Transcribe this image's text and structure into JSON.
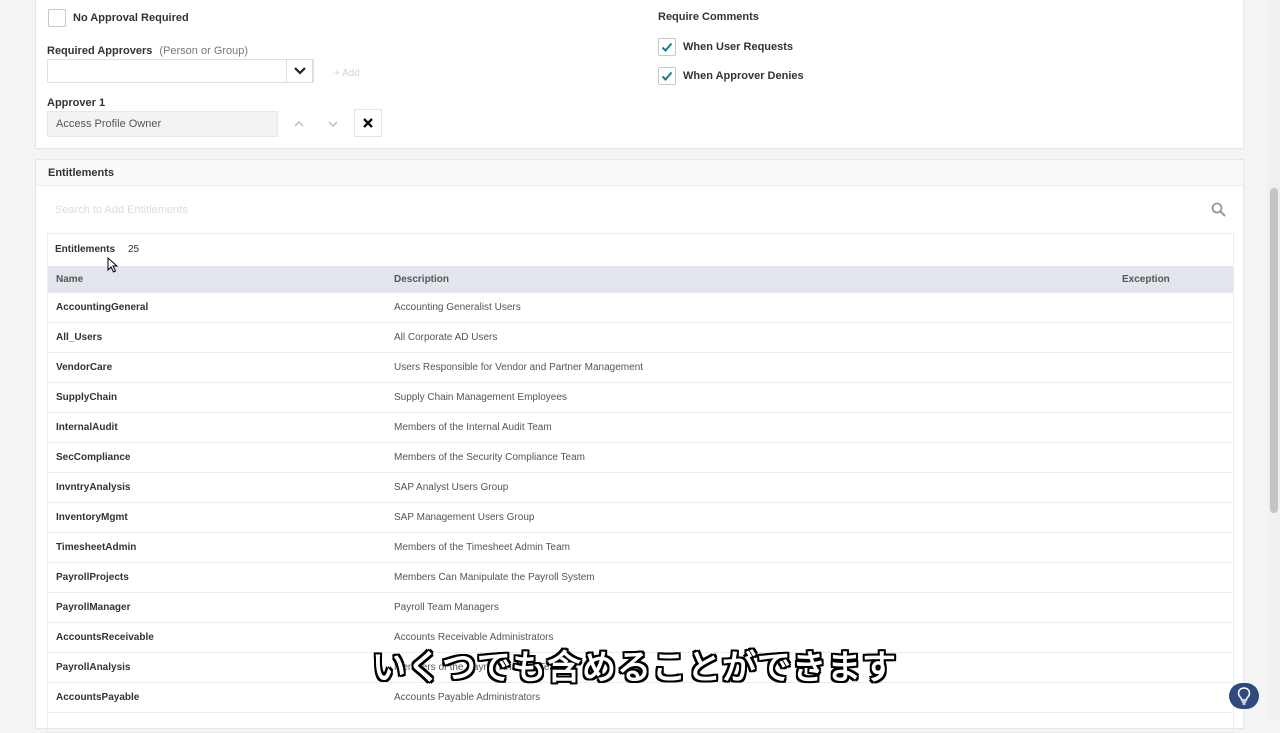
{
  "approvals": {
    "no_approval_label": "No Approval Required",
    "no_approval_checked": false,
    "required_approvers_label": "Required Approvers",
    "required_approvers_hint": "(Person or Group)",
    "required_approvers_value": "",
    "add_label": "+ Add",
    "approver1_label": "Approver 1",
    "approver1_value": "Access Profile Owner",
    "require_comments_label": "Require Comments",
    "when_user_requests_label": "When User Requests",
    "when_user_requests_checked": true,
    "when_approver_denies_label": "When Approver Denies",
    "when_approver_denies_checked": true
  },
  "entitlements": {
    "section_title": "Entitlements",
    "search_placeholder": "Search to Add Entitlements",
    "table_title": "Entitlements",
    "count": "25",
    "columns": {
      "name": "Name",
      "description": "Description",
      "exception": "Exception"
    },
    "rows": [
      {
        "name": "AccountingGeneral",
        "description": "Accounting Generalist Users"
      },
      {
        "name": "All_Users",
        "description": "All Corporate AD Users"
      },
      {
        "name": "VendorCare",
        "description": "Users Responsible for Vendor and Partner Management"
      },
      {
        "name": "SupplyChain",
        "description": "Supply Chain Management Employees"
      },
      {
        "name": "InternalAudit",
        "description": "Members of the Internal Audit Team"
      },
      {
        "name": "SecCompliance",
        "description": "Members of the Security Compliance Team"
      },
      {
        "name": "InvntryAnalysis",
        "description": "SAP Analyst Users Group"
      },
      {
        "name": "InventoryMgmt",
        "description": "SAP Management Users Group"
      },
      {
        "name": "TimesheetAdmin",
        "description": "Members of the Timesheet Admin Team"
      },
      {
        "name": "PayrollProjects",
        "description": "Members Can Manipulate the Payroll System"
      },
      {
        "name": "PayrollManager",
        "description": "Payroll Team Managers"
      },
      {
        "name": "AccountsReceivable",
        "description": "Accounts Receivable Administrators"
      },
      {
        "name": "PayrollAnalysis",
        "description": "Members of the Payroll Analysis Team"
      },
      {
        "name": "AccountsPayable",
        "description": "Accounts Payable Administrators"
      }
    ]
  },
  "subtitle": "いくつでも含めることができます",
  "colors": {
    "accent": "#1a7a8a",
    "help_button": "#2f4a7c",
    "header_row": "#e3e5ec"
  },
  "icons": [
    "check-icon",
    "chevron-down-icon",
    "arrow-up-icon",
    "arrow-down-icon",
    "close-icon",
    "search-icon",
    "lightbulb-icon",
    "cursor-icon"
  ]
}
